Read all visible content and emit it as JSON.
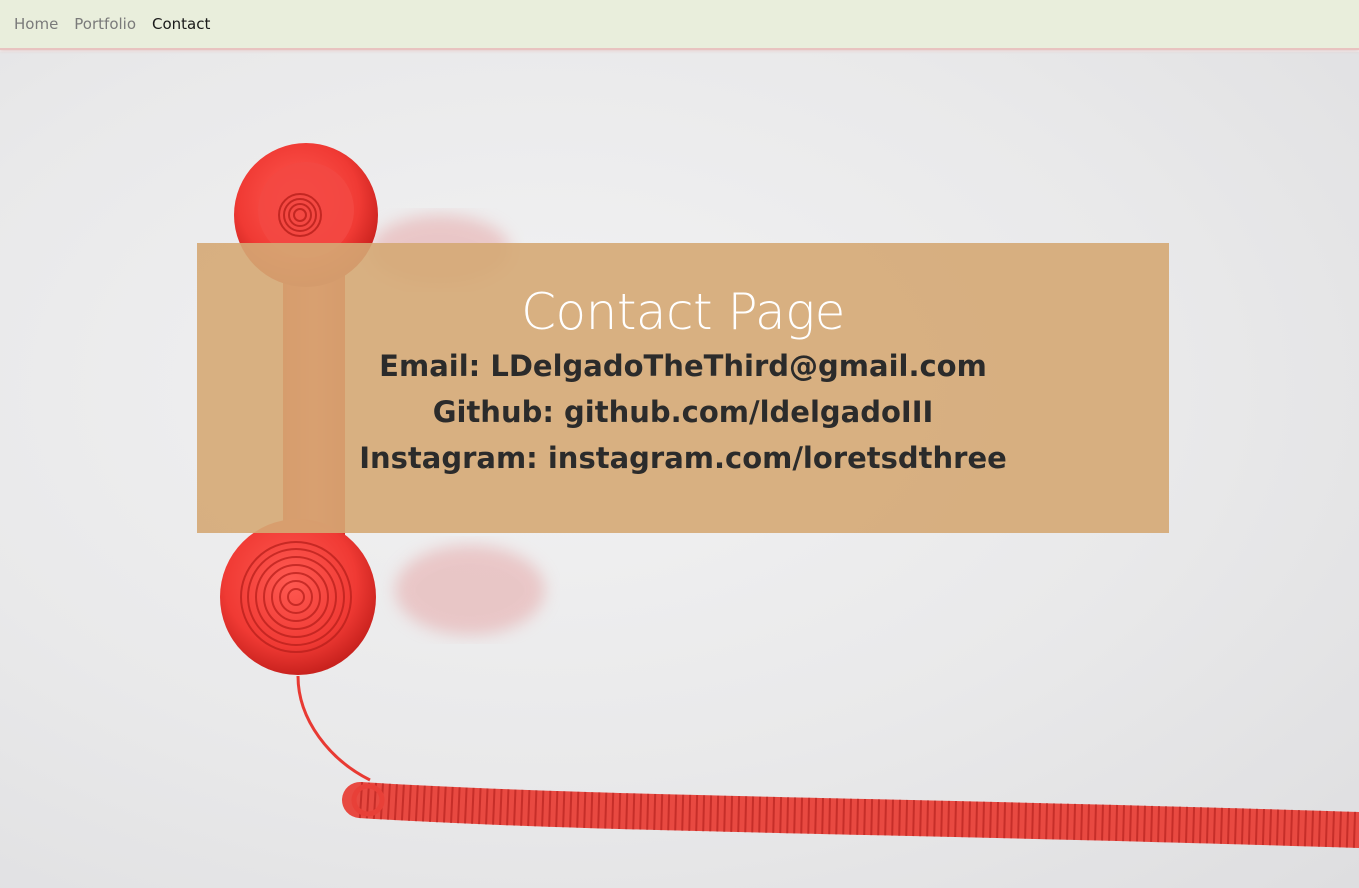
{
  "nav": {
    "items": [
      {
        "label": "Home"
      },
      {
        "label": "Portfolio"
      },
      {
        "label": "Contact"
      }
    ]
  },
  "contact": {
    "title": "Contact Page",
    "email": "Email: LDelgadoTheThird@gmail.com",
    "github": "Github: github.com/ldelgadoIII",
    "instagram": "Instagram: instagram.com/loretsdthree"
  },
  "colors": {
    "navbar_bg": "#e9eedc",
    "box_bg": "#d5a874",
    "phone_red": "#f0403a"
  }
}
